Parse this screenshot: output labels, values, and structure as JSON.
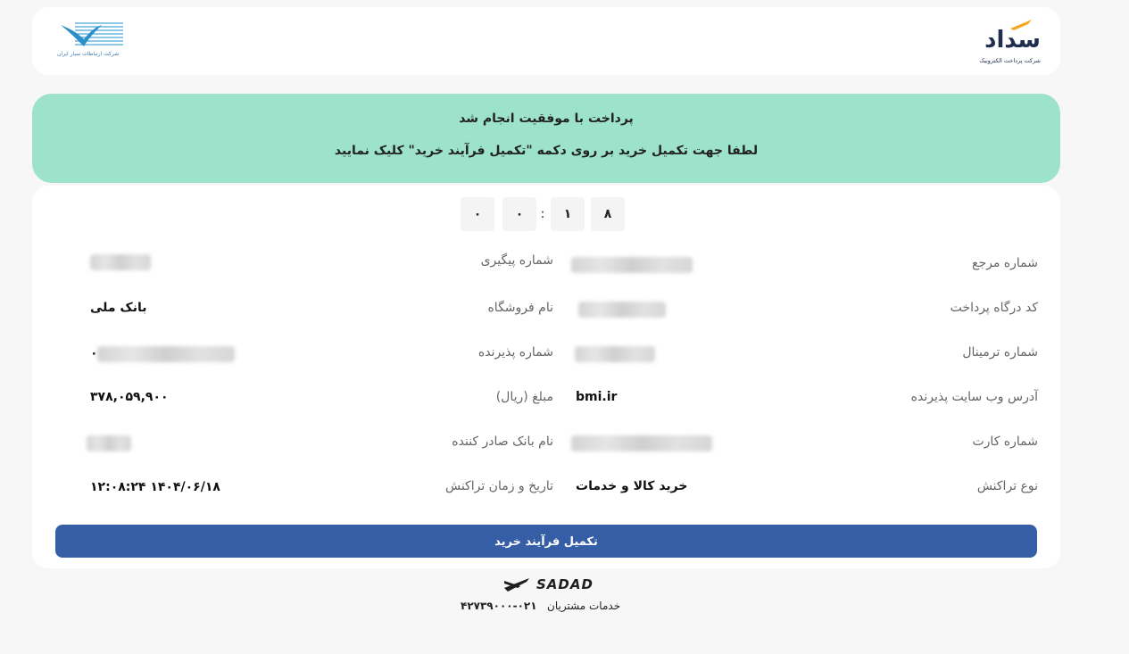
{
  "header": {
    "brand_name": "سداد",
    "brand_subtitle": "شرکت پرداخت الکترونیک",
    "partner_logo_text": "شرکت ارتباطات سیار ایران"
  },
  "banner": {
    "title": "پرداخت با موفقیت انجام شد",
    "instruction": "لطفا جهت تکمیل خرید بر روی دکمه \"تکمیل فرآیند خرید\" کلیک نمایید"
  },
  "timer": {
    "digits": [
      "۸",
      "۱",
      "۰",
      "۰"
    ],
    "separator": ":"
  },
  "fields": {
    "reference_number": {
      "label": "شماره مرجع"
    },
    "tracking_number": {
      "label": "شماره پیگیری"
    },
    "gateway_code": {
      "label": "کد درگاه پرداخت"
    },
    "store_name": {
      "label": "نام فروشگاه",
      "value": "بانک ملی"
    },
    "terminal_number": {
      "label": "شماره ترمینال"
    },
    "acceptor_number": {
      "label": "شماره پذیرنده",
      "value": "۰"
    },
    "acceptor_site": {
      "label": "آدرس وب سایت پذیرنده",
      "value": "bmi.ir"
    },
    "amount": {
      "label": "مبلغ (ریال)",
      "value": "۳۷۸,۰۵۹,۹۰۰"
    },
    "card_number": {
      "label": "شماره کارت"
    },
    "issuer_bank": {
      "label": "نام بانک صادر کننده"
    },
    "transaction_type": {
      "label": "نوع تراکنش",
      "value": "خرید کالا و خدمات"
    },
    "transaction_datetime": {
      "label": "تاریخ و زمان تراکنش",
      "value": "۱۴۰۴/۰۶/۱۸ ۱۲:۰۸:۲۴"
    }
  },
  "actions": {
    "complete_purchase": "تکمیل فرآیند خرید"
  },
  "footer": {
    "brand": "SADAD",
    "support_label": "خدمات مشتریان",
    "support_phone": "۰۲۱-۴۲۷۳۹۰۰۰"
  },
  "colors": {
    "banner_bg": "#9de3cc",
    "button_bg": "#365ea6",
    "brand_orange": "#f5a623",
    "brand_navy": "#1f2e4f"
  },
  "icons": {
    "sadad_logo": "sadad-logo-icon",
    "partner_logo": "bird-logo-icon",
    "footer_logo": "sadad-mark-icon"
  }
}
